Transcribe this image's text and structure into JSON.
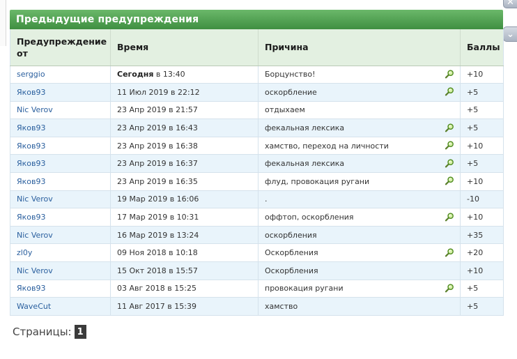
{
  "panel": {
    "title": "Предыдущие предупреждения"
  },
  "columns": {
    "from": "Предупреждение от",
    "time": "Время",
    "reason": "Причина",
    "points": "Баллы"
  },
  "rows": [
    {
      "from": "serggio",
      "time_bold": "Сегодня",
      "time": " в 13:40",
      "reason": "Борцунство!",
      "has_post_link": true,
      "points": "+10"
    },
    {
      "from": "Яков93",
      "time_bold": "",
      "time": "11 Июл 2019 в 22:12",
      "reason": "оскорбление",
      "has_post_link": true,
      "points": "+5"
    },
    {
      "from": "Nic Verov",
      "time_bold": "",
      "time": "23 Апр 2019 в 21:57",
      "reason": "отдыхаем",
      "has_post_link": false,
      "points": "+5"
    },
    {
      "from": "Яков93",
      "time_bold": "",
      "time": "23 Апр 2019 в 16:43",
      "reason": "фекальная лексика",
      "has_post_link": true,
      "points": "+5"
    },
    {
      "from": "Яков93",
      "time_bold": "",
      "time": "23 Апр 2019 в 16:38",
      "reason": "хамство, переход на личности",
      "has_post_link": true,
      "points": "+10"
    },
    {
      "from": "Яков93",
      "time_bold": "",
      "time": "23 Апр 2019 в 16:37",
      "reason": "фекальная лексика",
      "has_post_link": true,
      "points": "+5"
    },
    {
      "from": "Яков93",
      "time_bold": "",
      "time": "23 Апр 2019 в 16:35",
      "reason": "флуд, провокация ругани",
      "has_post_link": true,
      "points": "+10"
    },
    {
      "from": "Nic Verov",
      "time_bold": "",
      "time": "19 Мар 2019 в 16:06",
      "reason": ".",
      "has_post_link": false,
      "points": "-10"
    },
    {
      "from": "Яков93",
      "time_bold": "",
      "time": "17 Мар 2019 в 10:31",
      "reason": "оффтоп, оскорбления",
      "has_post_link": true,
      "points": "+10"
    },
    {
      "from": "Nic Verov",
      "time_bold": "",
      "time": "16 Мар 2019 в 13:24",
      "reason": "оскорбления",
      "has_post_link": false,
      "points": "+35"
    },
    {
      "from": "zl0y",
      "time_bold": "",
      "time": "09 Ноя 2018 в 10:18",
      "reason": "Оскорбления",
      "has_post_link": true,
      "points": "+20"
    },
    {
      "from": "Nic Verov",
      "time_bold": "",
      "time": "15 Окт 2018 в 15:57",
      "reason": "Оскорбления",
      "has_post_link": false,
      "points": "+10"
    },
    {
      "from": "Яков93",
      "time_bold": "",
      "time": "03 Авг 2018 в 15:25",
      "reason": "провокация ругани",
      "has_post_link": true,
      "points": "+5"
    },
    {
      "from": "WaveCut",
      "time_bold": "",
      "time": "11 Авг 2017 в 15:39",
      "reason": "хамство",
      "has_post_link": false,
      "points": "+5"
    }
  ],
  "pagination": {
    "label": "Страницы:",
    "current": "1"
  },
  "icons": {
    "post_link": "magnifier-icon",
    "close": "close-icon",
    "scroll_down": "chevron-down-icon"
  },
  "colors": {
    "header_green_top": "#6bb86a",
    "header_green_bottom": "#3f8f41",
    "link_blue": "#2a5f9e",
    "row_alt": "#e9f4fb"
  }
}
